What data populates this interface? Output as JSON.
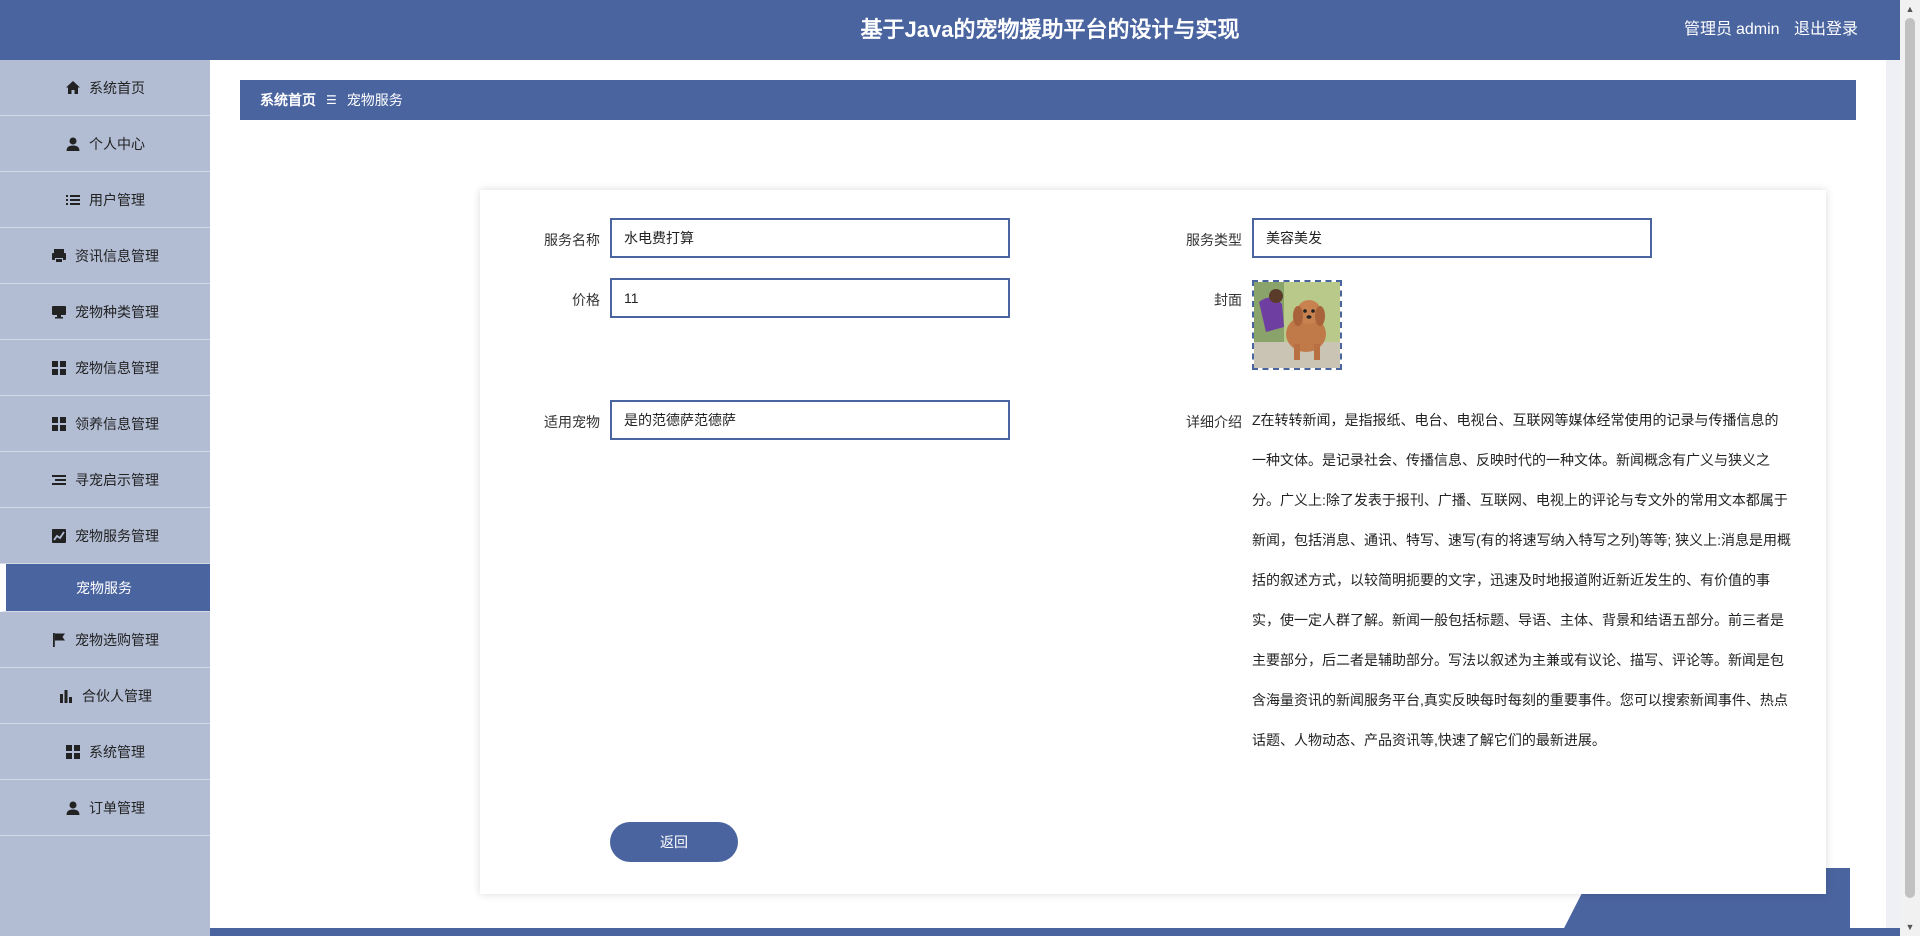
{
  "header": {
    "title": "基于Java的宠物援助平台的设计与实现",
    "role": "管理员",
    "username": "admin",
    "logout": "退出登录"
  },
  "colors": {
    "primary": "#4a64a0",
    "sidebar_bg": "#b2bdd4"
  },
  "sidebar": {
    "items": [
      {
        "label": "系统首页",
        "icon": "home-icon"
      },
      {
        "label": "个人中心",
        "icon": "person-icon"
      },
      {
        "label": "用户管理",
        "icon": "list-icon"
      },
      {
        "label": "资讯信息管理",
        "icon": "printer-icon"
      },
      {
        "label": "宠物种类管理",
        "icon": "monitor-icon"
      },
      {
        "label": "宠物信息管理",
        "icon": "grid-icon"
      },
      {
        "label": "领养信息管理",
        "icon": "grid-icon"
      },
      {
        "label": "寻宠启示管理",
        "icon": "lines-icon"
      },
      {
        "label": "宠物服务管理",
        "icon": "chart-line-icon"
      },
      {
        "label": "宠物服务",
        "icon": "",
        "active_submenu": true
      },
      {
        "label": "宠物选购管理",
        "icon": "flag-icon"
      },
      {
        "label": "合伙人管理",
        "icon": "bar-chart-icon"
      },
      {
        "label": "系统管理",
        "icon": "grid-icon"
      },
      {
        "label": "订单管理",
        "icon": "person-icon"
      }
    ]
  },
  "breadcrumb": {
    "home": "系统首页",
    "separator": "☰",
    "current": "宠物服务"
  },
  "form": {
    "service_name_label": "服务名称",
    "service_name_value": "水电费打算",
    "service_type_label": "服务类型",
    "service_type_value": "美容美发",
    "price_label": "价格",
    "price_value": "11",
    "cover_label": "封面",
    "applicable_pet_label": "适用宠物",
    "applicable_pet_value": "是的范德萨范德萨",
    "detail_label": "详细介绍",
    "detail_text": "Z在转转新闻，是指报纸、电台、电视台、互联网等媒体经常使用的记录与传播信息的一种文体。是记录社会、传播信息、反映时代的一种文体。新闻概念有广义与狭义之分。广义上:除了发表于报刊、广播、互联网、电视上的评论与专文外的常用文本都属于新闻，包括消息、通讯、特写、速写(有的将速写纳入特写之列)等等; 狭义上:消息是用概括的叙述方式，以较简明扼要的文字，迅速及时地报道附近新近发生的、有价值的事实，使一定人群了解。新闻一般包括标题、导语、主体、背景和结语五部分。前三者是主要部分，后二者是辅助部分。写法以叙述为主兼或有议论、描写、评论等。新闻是包含海量资讯的新闻服务平台,真实反映每时每刻的重要事件。您可以搜索新闻事件、热点话题、人物动态、产品资讯等,快速了解它们的最新进展。",
    "back_button": "返回"
  }
}
